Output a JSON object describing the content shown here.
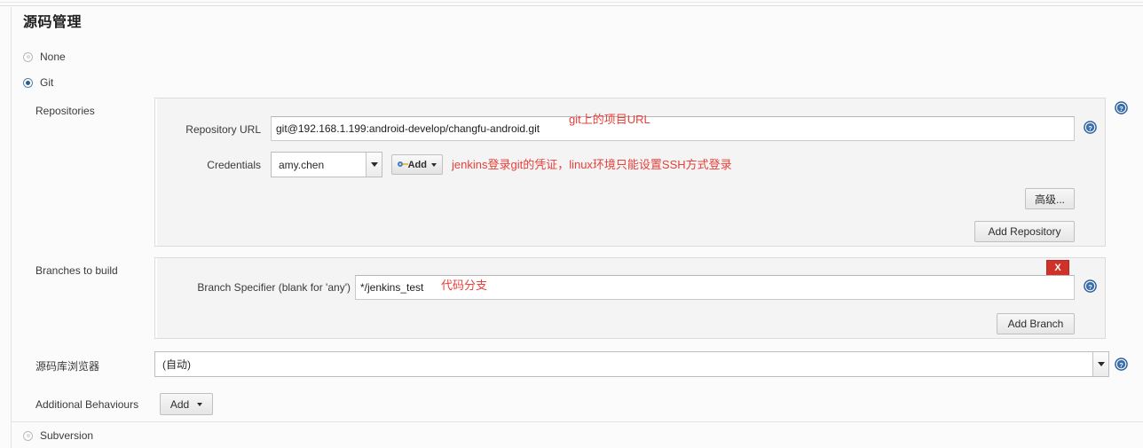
{
  "page": {
    "title": "源码管理"
  },
  "scm_options": [
    {
      "label": "None",
      "selected": false
    },
    {
      "label": "Git",
      "selected": true
    },
    {
      "label": "Subversion",
      "selected": false
    }
  ],
  "rows": {
    "repositories_label": "Repositories",
    "branches_label": "Branches to build",
    "browser_label": "源码库浏览器",
    "behaviours_label": "Additional Behaviours"
  },
  "repository": {
    "url_label": "Repository URL",
    "url_value": "git@192.168.1.199:android-develop/changfu-android.git",
    "credentials_label": "Credentials",
    "credentials_value": "amy.chen",
    "add_credentials_label": "Add",
    "advanced_label": "高级...",
    "add_repository_label": "Add Repository"
  },
  "branch": {
    "specifier_label": "Branch Specifier (blank for 'any')",
    "specifier_value": "*/jenkins_test",
    "delete_label": "X",
    "add_branch_label": "Add Branch"
  },
  "browser": {
    "value": "(自动)"
  },
  "behaviours": {
    "add_label": "Add"
  },
  "annotations": {
    "url_note": "git上的项目URL",
    "credentials_note": "jenkins登录git的凭证，linux环境只能设置SSH方式登录",
    "branch_note": "代码分支"
  },
  "icons": {
    "help": "help-icon",
    "key": "key-icon",
    "caret": "chevron-down-icon"
  },
  "colors": {
    "accent_red": "#cf3228",
    "annotation_red": "#e8403a",
    "radio_blue": "#2c5d8f",
    "help_blue": "#2f5f9e"
  }
}
